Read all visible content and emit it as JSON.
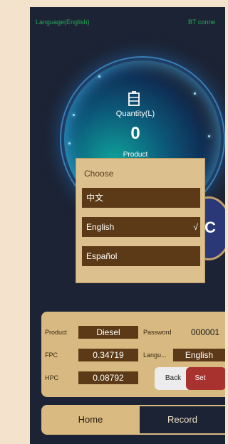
{
  "topbar": {
    "language": "Language(English)",
    "bt": "BT conne"
  },
  "gauge": {
    "quantity_label": "Quantity(L)",
    "quantity_value": "0",
    "product_peek": "Product",
    "badge_letter": "C"
  },
  "popup": {
    "title": "Choose",
    "options": [
      {
        "label": "中文",
        "selected": false
      },
      {
        "label": "English",
        "selected": true,
        "check": "√"
      },
      {
        "label": "Español",
        "selected": false
      }
    ]
  },
  "panel": {
    "product_label": "Product",
    "product_value": "Diesel",
    "password_label": "Password",
    "password_value": "000001",
    "fpc_label": "FPC",
    "fpc_value": "0.34719",
    "language_label": "Langu...",
    "language_value": "English",
    "hpc_label": "HPC",
    "hpc_value": "0.08792",
    "back_label": "Back",
    "set_label": "Set"
  },
  "tabs": {
    "home": "Home",
    "record": "Record"
  },
  "colors": {
    "accent_gold": "#d7b981",
    "dark_brown": "#5c3a17",
    "bg_dark": "#1c2334",
    "set_red": "#a8332e",
    "status_green": "#27a85a"
  }
}
